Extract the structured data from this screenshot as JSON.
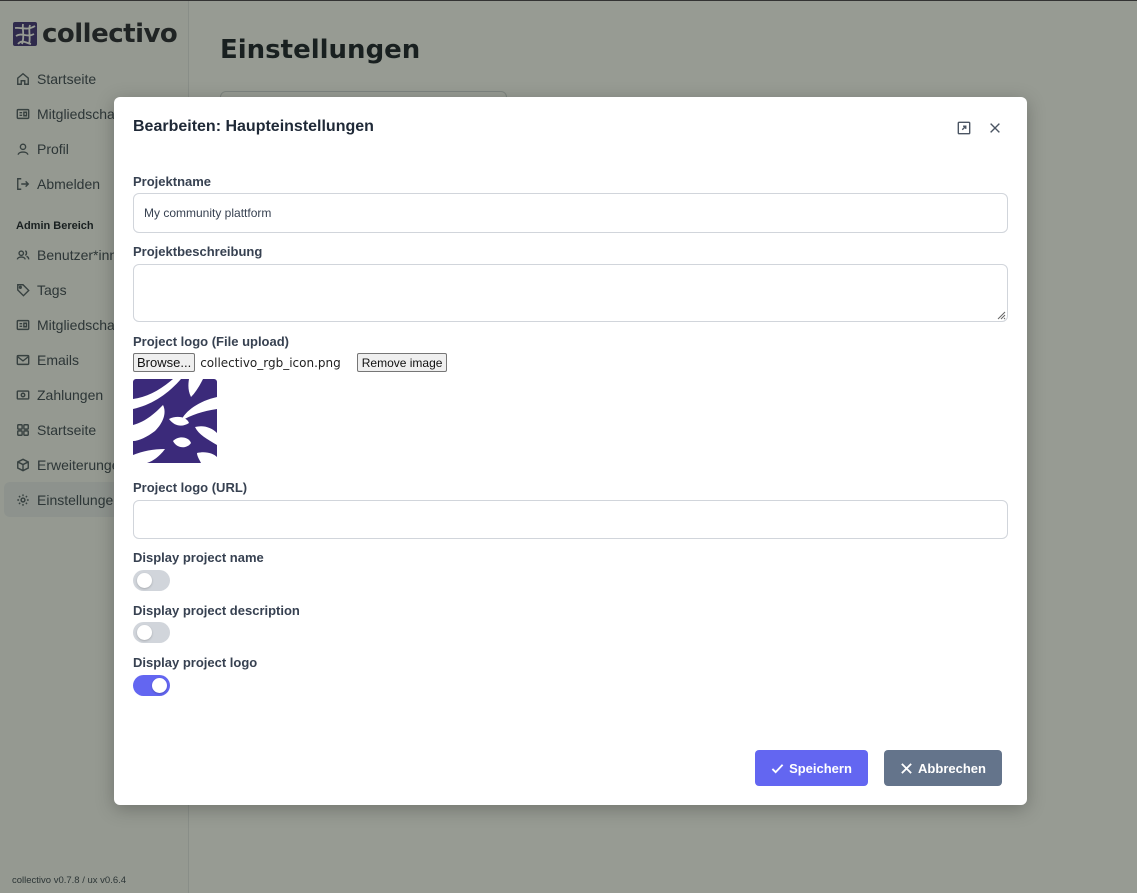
{
  "app": {
    "name": "collectivo",
    "version": "collectivo v0.7.8 / ux v0.6.4"
  },
  "sidebar": {
    "items": [
      {
        "label": "Startseite",
        "icon": "home-icon"
      },
      {
        "label": "Mitgliedschaften",
        "icon": "id-card-icon"
      },
      {
        "label": "Profil",
        "icon": "user-icon"
      },
      {
        "label": "Abmelden",
        "icon": "logout-icon"
      }
    ],
    "admin_title": "Admin Bereich",
    "admin_items": [
      {
        "label": "Benutzer*innen",
        "icon": "users-icon"
      },
      {
        "label": "Tags",
        "icon": "tag-icon"
      },
      {
        "label": "Mitgliedschaften",
        "icon": "id-card-icon"
      },
      {
        "label": "Emails",
        "icon": "mail-icon"
      },
      {
        "label": "Zahlungen",
        "icon": "banknote-icon"
      },
      {
        "label": "Startseite",
        "icon": "grid-icon"
      },
      {
        "label": "Erweiterungen",
        "icon": "package-icon"
      },
      {
        "label": "Einstellungen",
        "icon": "gear-icon",
        "active": true
      }
    ]
  },
  "main": {
    "title": "Einstellungen"
  },
  "modal": {
    "title": "Bearbeiten: Haupteinstellungen",
    "fields": {
      "project_name": {
        "label": "Projektname",
        "value": "My community plattform"
      },
      "project_description": {
        "label": "Projektbeschreibung",
        "value": ""
      },
      "logo_upload": {
        "label": "Project logo (File upload)",
        "browse_label": "Browse...",
        "file_name": "collectivo_rgb_icon.png",
        "remove_label": "Remove image"
      },
      "logo_url": {
        "label": "Project logo (URL)",
        "value": ""
      },
      "display_name": {
        "label": "Display project name",
        "enabled": false
      },
      "display_description": {
        "label": "Display project description",
        "enabled": false
      },
      "display_logo": {
        "label": "Display project logo",
        "enabled": true
      }
    },
    "buttons": {
      "save": "Speichern",
      "cancel": "Abbrechen"
    }
  },
  "colors": {
    "brand": "#3b2a7a",
    "primary": "#6366f1",
    "secondary": "#64748b"
  }
}
